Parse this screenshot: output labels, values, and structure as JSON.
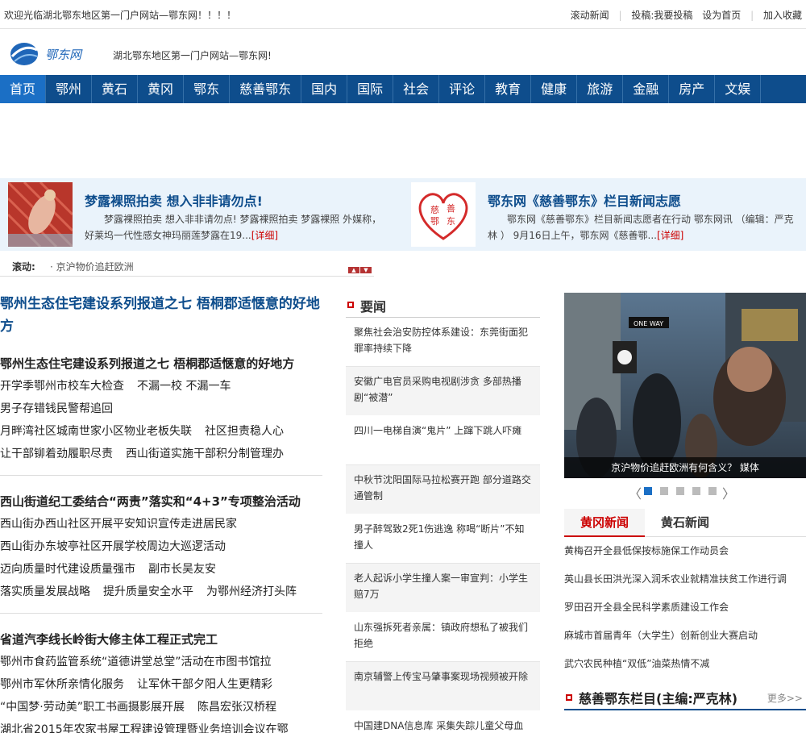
{
  "topbar": {
    "welcome": "欢迎光临湖北鄂东地区第一门户网站—鄂东网！！！！",
    "links": [
      "滚动新闻",
      "投稿:我要投稿",
      "设为首页",
      "加入收藏"
    ]
  },
  "header": {
    "logo_text": "鄂东网",
    "slogan": "湖北鄂东地区第一门户网站—鄂东网!"
  },
  "nav": [
    "首页",
    "鄂州",
    "黄石",
    "黄冈",
    "鄂东",
    "慈善鄂东",
    "国内",
    "国际",
    "社会",
    "评论",
    "教育",
    "健康",
    "旅游",
    "金融",
    "房产",
    "文娱"
  ],
  "feature": [
    {
      "title": "梦露裸照拍卖  想入非非请勿点!",
      "desc": "梦露裸照拍卖 想入非非请勿点! 梦露裸照拍卖 梦露裸照     外媒称，好莱坞一代性感女神玛丽莲梦露在19...",
      "more": "[详细]"
    },
    {
      "title": "鄂东网《慈善鄂东》栏目新闻志愿",
      "desc": "鄂东网《慈善鄂东》栏目新闻志愿者在行动     鄂东网讯 （编辑：严克林 ） 9月16日上午，鄂东网《慈善鄂...",
      "more": "[详细]",
      "logo_chars": [
        "慈",
        "善",
        "鄂",
        "东"
      ]
    }
  ],
  "scroll": {
    "label": "滚动:",
    "text": "· 京沪物价追赶欧洲",
    "arrow_up": "▲",
    "arrow_down": "▼"
  },
  "left": {
    "headline": "鄂州生态住宅建设系列报道之七 梧桐郡适惬意的好地方",
    "blocks": [
      {
        "title": "鄂州生态住宅建设系列报道之七  梧桐郡适惬意的好地方",
        "rows": [
          [
            "开学季鄂州市校车大检查",
            "不漏一校  不漏一车"
          ],
          [
            "男子存错钱民警帮追回"
          ],
          [
            "月畔湾社区城南世家小区物业老板失联",
            "社区担责稳人心"
          ],
          [
            "让干部铆着劲履职尽责",
            "西山街道实施干部积分制管理办"
          ]
        ]
      },
      {
        "title": "西山街道纪工委结合“两责”落实和“4+3”专项整治活动",
        "rows": [
          [
            "西山街办西山社区开展平安知识宣传走进居民家"
          ],
          [
            "西山街办东坡亭社区开展学校周边大巡逻活动"
          ],
          [
            "迈向质量时代建设质量强市",
            "副市长吴友安"
          ],
          [
            "落实质量发展战略",
            "提升质量安全水平",
            "为鄂州经济打头阵"
          ]
        ]
      },
      {
        "title": "省道汽李线长岭街大修主体工程正式完工",
        "rows": [
          [
            "鄂州市食药监管系统“道德讲堂总堂”活动在市图书馆拉"
          ],
          [
            "鄂州市军休所亲情化服务",
            "让军休干部夕阳人生更精彩"
          ],
          [
            "“中国梦·劳动美”职工书画摄影展开展",
            "陈昌宏张汉桥程"
          ],
          [
            "湖北省2015年农家书屋工程建设管理暨业务培训会议在鄂"
          ]
        ]
      }
    ]
  },
  "mid": {
    "title": "要闻",
    "news": [
      "聚焦社会治安防控体系建设：东莞街面犯罪率持续下降",
      "安徽广电官员采购电视剧涉贪 多部热播剧“被潜”",
      "四川一电梯自演“鬼片” 上蹿下跳人吓瘫",
      "中秋节沈阳国际马拉松赛开跑 部分道路交通管制",
      "男子醉驾致2死1伤逃逸 称喝“断片”不知撞人",
      "老人起诉小学生撞人案一审宣判：小学生赔7万",
      "山东强拆死者亲属：镇政府想私了被我们拒绝",
      "南京辅警上传宝马肇事案现场视频被开除",
      "中国建DNA信息库 采集失踪儿童父母血样"
    ]
  },
  "right": {
    "photo_caption": "京沪物价追赶欧洲有何含义？ 媒体",
    "sign_text": "ONE WAY",
    "arrow_left": "〈",
    "arrow_right": "〉",
    "tabs": [
      "黄冈新闻",
      "黄石新闻"
    ],
    "list": [
      "黄梅召开全县低保按标施保工作动员会",
      "英山县长田洪光深入润禾农业就精准扶贫工作进行调",
      "罗田召开全县全民科学素质建设工作会",
      "麻城市首届青年（大学生）创新创业大赛启动",
      "武穴农民种植“双低”油菜热情不减"
    ],
    "section_title": "慈善鄂东栏目(主编:严克林)",
    "section_more": "更多>>"
  }
}
